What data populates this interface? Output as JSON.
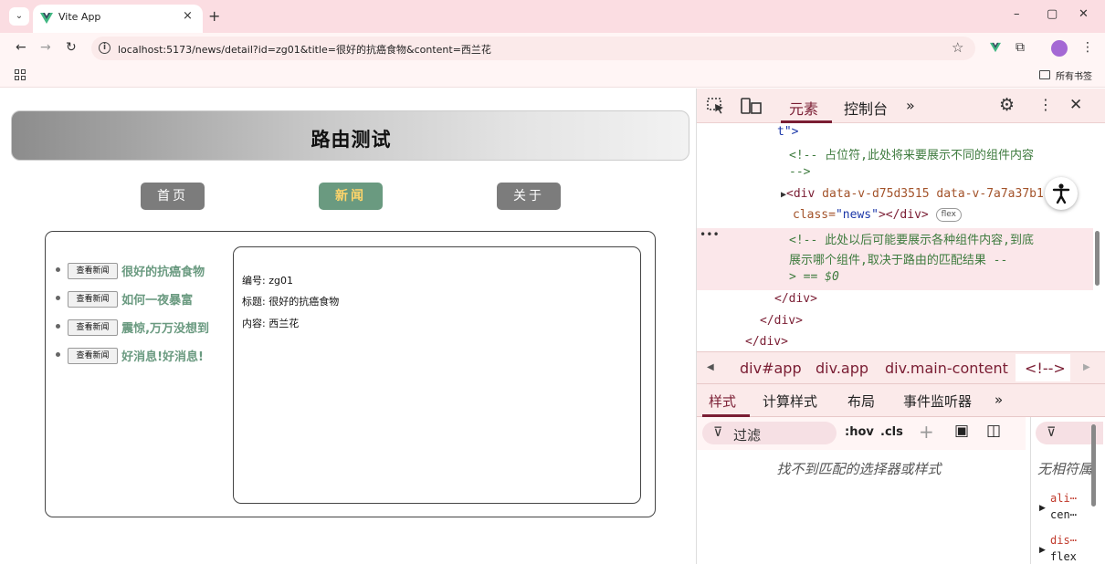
{
  "browser": {
    "tab_title": "Vite App",
    "tab_close": "×",
    "new_tab": "+",
    "url": "localhost:5173/news/detail?id=zg01&title=很好的抗癌食物&content=西兰花",
    "bookmarks_label": "所有书签",
    "window_controls": {
      "minimize": "–",
      "restore": "▢",
      "close": "✕"
    },
    "nav": {
      "back": "←",
      "forward": "→",
      "reload": "↻"
    },
    "icons": [
      "tab-menu-icon",
      "vue-favicon-icon",
      "info-icon",
      "star-icon",
      "vue-extension-icon",
      "extensions-icon",
      "profile-icon",
      "more-icon",
      "apps-icon",
      "folder-icon"
    ],
    "colors": {
      "tabbar": "#fbdde2",
      "toolbar": "#fff5f5",
      "profile": "#a468d4"
    }
  },
  "page": {
    "title": "路由测试",
    "nav_links": [
      {
        "label": "首页",
        "active": false
      },
      {
        "label": "新闻",
        "active": true
      },
      {
        "label": "关于",
        "active": false
      }
    ],
    "news_button_label": "查看新闻",
    "news": [
      {
        "title": "很好的抗癌食物"
      },
      {
        "title": "如何一夜暴富"
      },
      {
        "title": "震惊,万万没想到"
      },
      {
        "title": "好消息!好消息!"
      }
    ],
    "detail": {
      "id_line": "编号: zg01",
      "title_line": "标题: 很好的抗癌食物",
      "content_line": "内容: 西兰花"
    },
    "colors": {
      "accent": "#6a9a80",
      "active_text": "#ffd56a",
      "nav_bg": "#7c7c7c"
    }
  },
  "devtools": {
    "tabs": [
      "元素",
      "控制台"
    ],
    "more_tabs": "»",
    "code": {
      "line1": "t\">",
      "line2": "<!-- 占位符,此处将来要展示不同的组件内容",
      "line3": "-->",
      "line4_tag": "<div",
      "line4_attr1": "data-v-d75d3515",
      "line4_attr2": "data-v-7a7a37b1",
      "line5_attr": "class=",
      "line5_val": "\"news\"",
      "line5_rest": "></div>",
      "ellipsis": "⋯",
      "badge": "flex",
      "line6": "<!-- 此处以后可能要展示各种组件内容,到底",
      "line7": "展示哪个组件,取决于路由的匹配结果 --",
      "line8": "> == $0",
      "line9": "</div>",
      "line10": "</div>",
      "line11": "</div>",
      "row_marker": "•••"
    },
    "breadcrumbs": [
      "div#app",
      "div.app",
      "div.main-content",
      "<!-->"
    ],
    "styles_tabs": [
      "样式",
      "计算样式",
      "布局",
      "事件监听器"
    ],
    "filter_placeholder": "过滤",
    "filter_tools": [
      ":hov",
      ".cls"
    ],
    "no_match_text": "找不到匹配的选择器或样式",
    "computed": {
      "filter_icon": "⊽",
      "none_text": "无相符属",
      "props": [
        {
          "name": "ali⋯",
          "value": "cen⋯"
        },
        {
          "name": "dis⋯",
          "value": "flex"
        }
      ]
    },
    "colors": {
      "accent": "#7a1d33",
      "comment": "#3e7b3e",
      "toolbar_bg": "#fbeaea"
    }
  }
}
